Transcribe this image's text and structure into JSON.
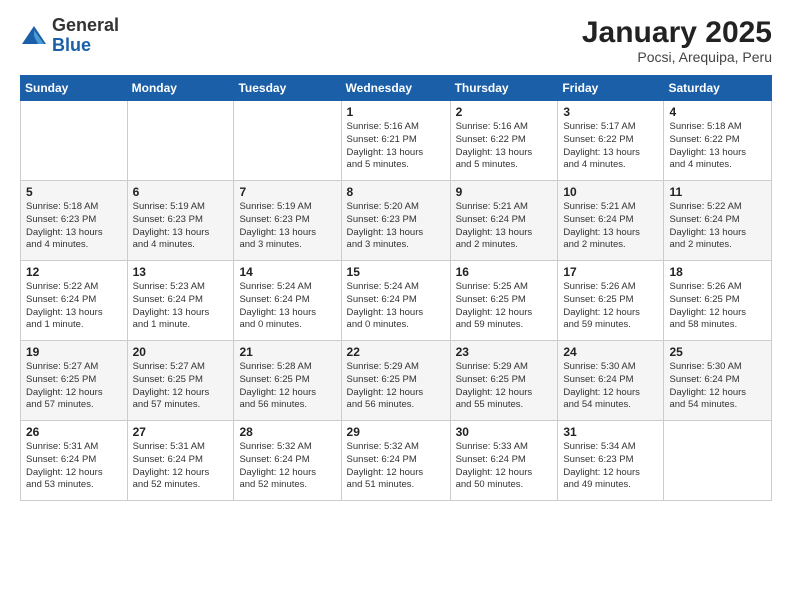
{
  "logo": {
    "general": "General",
    "blue": "Blue"
  },
  "title": "January 2025",
  "subtitle": "Pocsi, Arequipa, Peru",
  "days_header": [
    "Sunday",
    "Monday",
    "Tuesday",
    "Wednesday",
    "Thursday",
    "Friday",
    "Saturday"
  ],
  "weeks": [
    [
      {
        "day": "",
        "info": ""
      },
      {
        "day": "",
        "info": ""
      },
      {
        "day": "",
        "info": ""
      },
      {
        "day": "1",
        "info": "Sunrise: 5:16 AM\nSunset: 6:21 PM\nDaylight: 13 hours\nand 5 minutes."
      },
      {
        "day": "2",
        "info": "Sunrise: 5:16 AM\nSunset: 6:22 PM\nDaylight: 13 hours\nand 5 minutes."
      },
      {
        "day": "3",
        "info": "Sunrise: 5:17 AM\nSunset: 6:22 PM\nDaylight: 13 hours\nand 4 minutes."
      },
      {
        "day": "4",
        "info": "Sunrise: 5:18 AM\nSunset: 6:22 PM\nDaylight: 13 hours\nand 4 minutes."
      }
    ],
    [
      {
        "day": "5",
        "info": "Sunrise: 5:18 AM\nSunset: 6:23 PM\nDaylight: 13 hours\nand 4 minutes."
      },
      {
        "day": "6",
        "info": "Sunrise: 5:19 AM\nSunset: 6:23 PM\nDaylight: 13 hours\nand 4 minutes."
      },
      {
        "day": "7",
        "info": "Sunrise: 5:19 AM\nSunset: 6:23 PM\nDaylight: 13 hours\nand 3 minutes."
      },
      {
        "day": "8",
        "info": "Sunrise: 5:20 AM\nSunset: 6:23 PM\nDaylight: 13 hours\nand 3 minutes."
      },
      {
        "day": "9",
        "info": "Sunrise: 5:21 AM\nSunset: 6:24 PM\nDaylight: 13 hours\nand 2 minutes."
      },
      {
        "day": "10",
        "info": "Sunrise: 5:21 AM\nSunset: 6:24 PM\nDaylight: 13 hours\nand 2 minutes."
      },
      {
        "day": "11",
        "info": "Sunrise: 5:22 AM\nSunset: 6:24 PM\nDaylight: 13 hours\nand 2 minutes."
      }
    ],
    [
      {
        "day": "12",
        "info": "Sunrise: 5:22 AM\nSunset: 6:24 PM\nDaylight: 13 hours\nand 1 minute."
      },
      {
        "day": "13",
        "info": "Sunrise: 5:23 AM\nSunset: 6:24 PM\nDaylight: 13 hours\nand 1 minute."
      },
      {
        "day": "14",
        "info": "Sunrise: 5:24 AM\nSunset: 6:24 PM\nDaylight: 13 hours\nand 0 minutes."
      },
      {
        "day": "15",
        "info": "Sunrise: 5:24 AM\nSunset: 6:24 PM\nDaylight: 13 hours\nand 0 minutes."
      },
      {
        "day": "16",
        "info": "Sunrise: 5:25 AM\nSunset: 6:25 PM\nDaylight: 12 hours\nand 59 minutes."
      },
      {
        "day": "17",
        "info": "Sunrise: 5:26 AM\nSunset: 6:25 PM\nDaylight: 12 hours\nand 59 minutes."
      },
      {
        "day": "18",
        "info": "Sunrise: 5:26 AM\nSunset: 6:25 PM\nDaylight: 12 hours\nand 58 minutes."
      }
    ],
    [
      {
        "day": "19",
        "info": "Sunrise: 5:27 AM\nSunset: 6:25 PM\nDaylight: 12 hours\nand 57 minutes."
      },
      {
        "day": "20",
        "info": "Sunrise: 5:27 AM\nSunset: 6:25 PM\nDaylight: 12 hours\nand 57 minutes."
      },
      {
        "day": "21",
        "info": "Sunrise: 5:28 AM\nSunset: 6:25 PM\nDaylight: 12 hours\nand 56 minutes."
      },
      {
        "day": "22",
        "info": "Sunrise: 5:29 AM\nSunset: 6:25 PM\nDaylight: 12 hours\nand 56 minutes."
      },
      {
        "day": "23",
        "info": "Sunrise: 5:29 AM\nSunset: 6:25 PM\nDaylight: 12 hours\nand 55 minutes."
      },
      {
        "day": "24",
        "info": "Sunrise: 5:30 AM\nSunset: 6:24 PM\nDaylight: 12 hours\nand 54 minutes."
      },
      {
        "day": "25",
        "info": "Sunrise: 5:30 AM\nSunset: 6:24 PM\nDaylight: 12 hours\nand 54 minutes."
      }
    ],
    [
      {
        "day": "26",
        "info": "Sunrise: 5:31 AM\nSunset: 6:24 PM\nDaylight: 12 hours\nand 53 minutes."
      },
      {
        "day": "27",
        "info": "Sunrise: 5:31 AM\nSunset: 6:24 PM\nDaylight: 12 hours\nand 52 minutes."
      },
      {
        "day": "28",
        "info": "Sunrise: 5:32 AM\nSunset: 6:24 PM\nDaylight: 12 hours\nand 52 minutes."
      },
      {
        "day": "29",
        "info": "Sunrise: 5:32 AM\nSunset: 6:24 PM\nDaylight: 12 hours\nand 51 minutes."
      },
      {
        "day": "30",
        "info": "Sunrise: 5:33 AM\nSunset: 6:24 PM\nDaylight: 12 hours\nand 50 minutes."
      },
      {
        "day": "31",
        "info": "Sunrise: 5:34 AM\nSunset: 6:23 PM\nDaylight: 12 hours\nand 49 minutes."
      },
      {
        "day": "",
        "info": ""
      }
    ]
  ]
}
